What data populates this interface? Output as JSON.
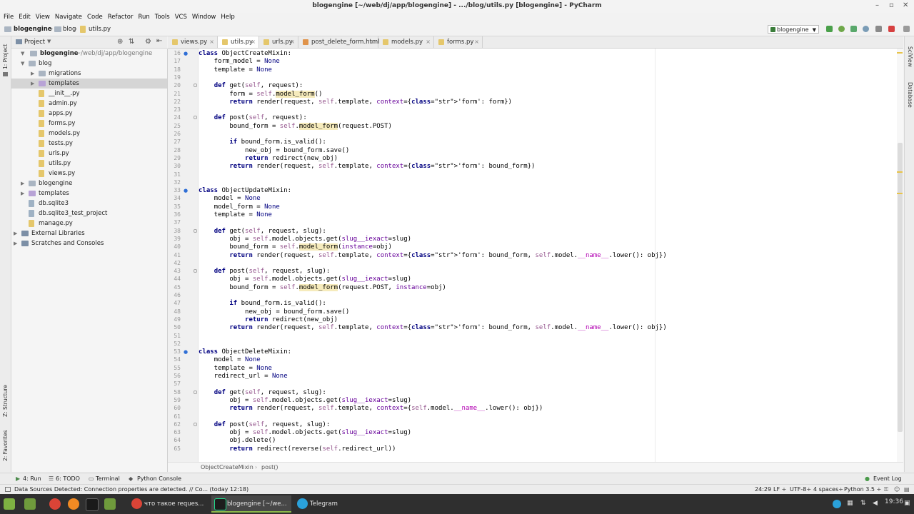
{
  "window": {
    "title": "blogengine [~/web/dj/app/blogengine] - .../blog/utils.py [blogengine] - PyCharm",
    "controls": [
      "–",
      "▫",
      "✕"
    ]
  },
  "menu": [
    "File",
    "Edit",
    "View",
    "Navigate",
    "Code",
    "Refactor",
    "Run",
    "Tools",
    "VCS",
    "Window",
    "Help"
  ],
  "breadcrumb": {
    "root": "blogengine",
    "folder": "blog",
    "file": "utils.py"
  },
  "run_config": {
    "label": "blogengine"
  },
  "left_strip": {
    "project": "1: Project",
    "structure": "Z: Structure",
    "favorites": "2: Favorites"
  },
  "right_strip": {
    "sciview": "SciView",
    "database": "Database"
  },
  "project_panel": {
    "title": "Project",
    "root_label": "blogengine",
    "root_path": "~/web/dj/app/blogengine",
    "tree": [
      {
        "label": "blog",
        "type": "folder",
        "level": 1,
        "expanded": true
      },
      {
        "label": "migrations",
        "type": "folder",
        "level": 2,
        "expanded": false
      },
      {
        "label": "templates",
        "type": "pfolder",
        "level": 2,
        "expanded": false,
        "selected": true
      },
      {
        "label": "__init__.py",
        "type": "py",
        "level": 2
      },
      {
        "label": "admin.py",
        "type": "py",
        "level": 2
      },
      {
        "label": "apps.py",
        "type": "py",
        "level": 2
      },
      {
        "label": "forms.py",
        "type": "py",
        "level": 2
      },
      {
        "label": "models.py",
        "type": "py",
        "level": 2
      },
      {
        "label": "tests.py",
        "type": "py",
        "level": 2
      },
      {
        "label": "urls.py",
        "type": "py",
        "level": 2
      },
      {
        "label": "utils.py",
        "type": "py",
        "level": 2
      },
      {
        "label": "views.py",
        "type": "py",
        "level": 2
      },
      {
        "label": "blogengine",
        "type": "folder",
        "level": 1,
        "expanded": false
      },
      {
        "label": "templates",
        "type": "pfolder",
        "level": 1,
        "expanded": false
      },
      {
        "label": "db.sqlite3",
        "type": "db",
        "level": 1
      },
      {
        "label": "db.sqlite3_test_project",
        "type": "db",
        "level": 1
      },
      {
        "label": "manage.py",
        "type": "py",
        "level": 1
      },
      {
        "label": "External Libraries",
        "type": "lib",
        "level": 0,
        "expanded": false
      },
      {
        "label": "Scratches and Consoles",
        "type": "lib",
        "level": 0,
        "expanded": false
      }
    ]
  },
  "tabs": [
    {
      "label": "views.py",
      "active": false
    },
    {
      "label": "utils.py",
      "active": true
    },
    {
      "label": "urls.py",
      "active": false
    },
    {
      "label": "post_delete_form.html",
      "active": false
    },
    {
      "label": "models.py",
      "active": false
    },
    {
      "label": "forms.py",
      "active": false
    }
  ],
  "code_lines": [
    {
      "n": "16",
      "t": "class ObjectCreateMixin:"
    },
    {
      "n": "17",
      "t": "    form_model = None"
    },
    {
      "n": "18",
      "t": "    template = None"
    },
    {
      "n": "19",
      "t": ""
    },
    {
      "n": "20",
      "t": "    def get(self, request):"
    },
    {
      "n": "21",
      "t": "        form = self.model_form()"
    },
    {
      "n": "22",
      "t": "        return render(request, self.template, context={'form': form})"
    },
    {
      "n": "23",
      "t": ""
    },
    {
      "n": "24",
      "t": "    def post(self, request):"
    },
    {
      "n": "25",
      "t": "        bound_form = self.model_form(request.POST)"
    },
    {
      "n": "26",
      "t": ""
    },
    {
      "n": "27",
      "t": "        if bound_form.is_valid():"
    },
    {
      "n": "28",
      "t": "            new_obj = bound_form.save()"
    },
    {
      "n": "29",
      "t": "            return redirect(new_obj)"
    },
    {
      "n": "30",
      "t": "        return render(request, self.template, context={'form': bound_form})"
    },
    {
      "n": "31",
      "t": ""
    },
    {
      "n": "32",
      "t": ""
    },
    {
      "n": "33",
      "t": "class ObjectUpdateMixin:"
    },
    {
      "n": "34",
      "t": "    model = None"
    },
    {
      "n": "35",
      "t": "    model_form = None"
    },
    {
      "n": "36",
      "t": "    template = None"
    },
    {
      "n": "37",
      "t": ""
    },
    {
      "n": "38",
      "t": "    def get(self, request, slug):"
    },
    {
      "n": "39",
      "t": "        obj = self.model.objects.get(slug__iexact=slug)"
    },
    {
      "n": "40",
      "t": "        bound_form = self.model_form(instance=obj)"
    },
    {
      "n": "41",
      "t": "        return render(request, self.template, context={'form': bound_form, self.model.__name__.lower(): obj})"
    },
    {
      "n": "42",
      "t": ""
    },
    {
      "n": "43",
      "t": "    def post(self, request, slug):"
    },
    {
      "n": "44",
      "t": "        obj = self.model.objects.get(slug__iexact=slug)"
    },
    {
      "n": "45",
      "t": "        bound_form = self.model_form(request.POST, instance=obj)"
    },
    {
      "n": "46",
      "t": ""
    },
    {
      "n": "47",
      "t": "        if bound_form.is_valid():"
    },
    {
      "n": "48",
      "t": "            new_obj = bound_form.save()"
    },
    {
      "n": "49",
      "t": "            return redirect(new_obj)"
    },
    {
      "n": "50",
      "t": "        return render(request, self.template, context={'form': bound_form, self.model.__name__.lower(): obj})"
    },
    {
      "n": "51",
      "t": ""
    },
    {
      "n": "52",
      "t": ""
    },
    {
      "n": "53",
      "t": "class ObjectDeleteMixin:"
    },
    {
      "n": "54",
      "t": "    model = None"
    },
    {
      "n": "55",
      "t": "    template = None"
    },
    {
      "n": "56",
      "t": "    redirect_url = None"
    },
    {
      "n": "57",
      "t": ""
    },
    {
      "n": "58",
      "t": "    def get(self, request, slug):"
    },
    {
      "n": "59",
      "t": "        obj = self.model.objects.get(slug__iexact=slug)"
    },
    {
      "n": "60",
      "t": "        return render(request, self.template, context={self.model.__name__.lower(): obj})"
    },
    {
      "n": "61",
      "t": ""
    },
    {
      "n": "62",
      "t": "    def post(self, request, slug):"
    },
    {
      "n": "63",
      "t": "        obj = self.model.objects.get(slug__iexact=slug)"
    },
    {
      "n": "64",
      "t": "        obj.delete()"
    },
    {
      "n": "65",
      "t": "        return redirect(reverse(self.redirect_url))"
    }
  ],
  "editor_breadcrumb": {
    "cls": "ObjectCreateMixin",
    "method": "post()"
  },
  "tool_windows": {
    "run": "4: Run",
    "todo": "6: TODO",
    "terminal": "Terminal",
    "python_console": "Python Console",
    "event_log": "Event Log"
  },
  "status": {
    "message": "Data Sources Detected: Connection properties are detected. // Co... (today 12:18)",
    "position": "24:29",
    "line_sep": "LF ÷",
    "encoding": "UTF-8÷",
    "indent": "4 spaces÷",
    "interpreter": "Python 3.5 ÷"
  },
  "taskbar": {
    "windows": [
      {
        "label": "что такое reques...",
        "active": false
      },
      {
        "label": "blogengine [~/we...",
        "active": true
      },
      {
        "label": "Telegram",
        "active": false
      }
    ],
    "clock": "19:36"
  },
  "colors": {
    "accent": "#2f6fd6",
    "highlight": "#f6ebbc",
    "keyword": "#000080",
    "string": "#008080",
    "self": "#94558d"
  }
}
